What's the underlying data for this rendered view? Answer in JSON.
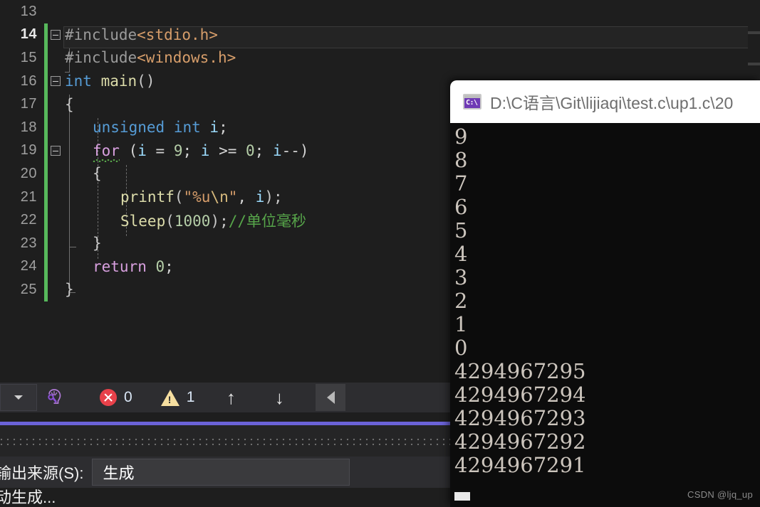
{
  "editor": {
    "first_line_number": 13,
    "current_line_number": 14,
    "lines": [
      {
        "num": "13",
        "tokens": []
      },
      {
        "num": "14",
        "tokens": [
          {
            "text": "#include",
            "cls": "t-pp"
          },
          {
            "text": "<stdio.h>",
            "cls": "t-inc"
          }
        ]
      },
      {
        "num": "15",
        "tokens": [
          {
            "text": "#include",
            "cls": "t-pp"
          },
          {
            "text": "<windows.h>",
            "cls": "t-inc"
          }
        ]
      },
      {
        "num": "16",
        "tokens": [
          {
            "text": "int",
            "cls": "t-kw"
          },
          {
            "text": " ",
            "cls": "t-plain"
          },
          {
            "text": "main",
            "cls": "t-fn"
          },
          {
            "text": "()",
            "cls": "t-brace"
          }
        ]
      },
      {
        "num": "17",
        "tokens": [
          {
            "text": "{",
            "cls": "t-brace"
          }
        ]
      },
      {
        "num": "18",
        "tokens": [
          {
            "text": "unsigned",
            "cls": "t-kw"
          },
          {
            "text": " ",
            "cls": "t-plain"
          },
          {
            "text": "int",
            "cls": "t-kw"
          },
          {
            "text": " ",
            "cls": "t-plain"
          },
          {
            "text": "i",
            "cls": "t-var"
          },
          {
            "text": ";",
            "cls": "t-punc"
          }
        ]
      },
      {
        "num": "19",
        "tokens": [
          {
            "text": "for",
            "cls": "t-ctl"
          },
          {
            "text": " (",
            "cls": "t-punc"
          },
          {
            "text": "i",
            "cls": "t-var"
          },
          {
            "text": " = ",
            "cls": "t-punc"
          },
          {
            "text": "9",
            "cls": "t-num"
          },
          {
            "text": "; ",
            "cls": "t-punc"
          },
          {
            "text": "i",
            "cls": "t-var"
          },
          {
            "text": " >= ",
            "cls": "t-punc"
          },
          {
            "text": "0",
            "cls": "t-num"
          },
          {
            "text": "; ",
            "cls": "t-punc"
          },
          {
            "text": "i",
            "cls": "t-var"
          },
          {
            "text": "--)",
            "cls": "t-punc"
          }
        ]
      },
      {
        "num": "20",
        "tokens": [
          {
            "text": "{",
            "cls": "t-brace"
          }
        ]
      },
      {
        "num": "21",
        "tokens": [
          {
            "text": "printf",
            "cls": "t-fn"
          },
          {
            "text": "(",
            "cls": "t-brace"
          },
          {
            "text": "\"%u",
            "cls": "t-str"
          },
          {
            "text": "\\n",
            "cls": "t-esc"
          },
          {
            "text": "\"",
            "cls": "t-str"
          },
          {
            "text": ", ",
            "cls": "t-punc"
          },
          {
            "text": "i",
            "cls": "t-var"
          },
          {
            "text": ");",
            "cls": "t-brace"
          }
        ]
      },
      {
        "num": "22",
        "tokens": [
          {
            "text": "Sleep",
            "cls": "t-fn"
          },
          {
            "text": "(",
            "cls": "t-brace"
          },
          {
            "text": "1000",
            "cls": "t-num"
          },
          {
            "text": ");",
            "cls": "t-brace"
          },
          {
            "text": "//单位毫秒",
            "cls": "t-cmt"
          }
        ]
      },
      {
        "num": "23",
        "tokens": [
          {
            "text": "}",
            "cls": "t-brace"
          }
        ]
      },
      {
        "num": "24",
        "tokens": [
          {
            "text": "return",
            "cls": "t-ctl"
          },
          {
            "text": " ",
            "cls": "t-plain"
          },
          {
            "text": "0",
            "cls": "t-num"
          },
          {
            "text": ";",
            "cls": "t-punc"
          }
        ]
      },
      {
        "num": "25",
        "tokens": [
          {
            "text": "}",
            "cls": "t-brace"
          }
        ]
      }
    ],
    "squiggle_token": "for",
    "change_bar_color": "#57b85c"
  },
  "error_list_toolbar": {
    "filter_dropdown_label": "",
    "intellisense_icon": "intellisense-head-wrench-icon",
    "error_icon": "error-circle-x-icon",
    "error_count": "0",
    "warning_icon": "warning-triangle-icon",
    "warning_count": "1",
    "prev_arrow": "↑",
    "next_arrow": "↓",
    "collapse_icon": "triangle-left-icon",
    "accent_color": "#6b63d8"
  },
  "output_pane": {
    "source_label": "输出来源(S):",
    "source_value": "生成",
    "body_text": "动生成..."
  },
  "console": {
    "title": "D:\\C语言\\Git\\lijiaqi\\test.c\\up1.c\\20",
    "icon": "cmd-console-icon",
    "icon_text": "C:\\",
    "lines": [
      "9",
      "8",
      "7",
      "6",
      "5",
      "4",
      "3",
      "2",
      "1",
      "0",
      "4294967295",
      "4294967294",
      "4294967293",
      "4294967292",
      "4294967291"
    ]
  },
  "watermark": {
    "text": "CSDN @ljq_up"
  }
}
